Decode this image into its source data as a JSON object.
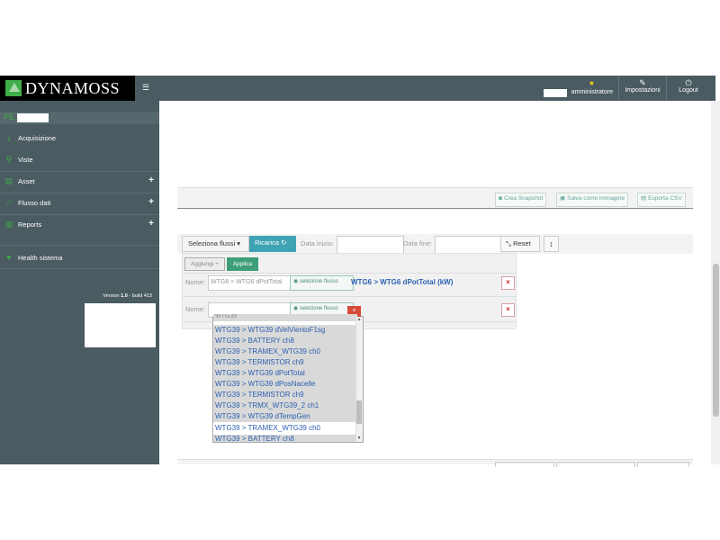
{
  "brand": {
    "name": "DYNAMOSS",
    "accent": "#3fae49"
  },
  "topbar": {
    "user_label": "amministratore",
    "user_icon": "user-icon",
    "settings_label": "Impostazioni",
    "settings_icon": "wrench-icon",
    "logout_label": "Logout",
    "logout_icon": "power-icon"
  },
  "sidebar": {
    "section_label": "PE",
    "items": [
      {
        "label": "Acquisizione",
        "icon": "download-icon"
      },
      {
        "label": "Viste",
        "icon": "map-marker-icon"
      },
      {
        "label": "Asset",
        "icon": "table-icon",
        "expandable": true
      },
      {
        "label": "Flusso dati",
        "icon": "line-chart-icon",
        "expandable": true
      },
      {
        "label": "Reports",
        "icon": "bar-chart-icon",
        "expandable": true
      },
      {
        "label": "Health sistema",
        "icon": "heart-icon"
      }
    ],
    "version_prefix": "Version ",
    "version_number": "1.0",
    "version_build": " - build 413"
  },
  "chart_toolbar": {
    "snapshot_label": "Crea Snapshot",
    "save_image_label": "Salva come immagine",
    "export_csv_label": "Esporta CSV"
  },
  "filters": {
    "seleziona_label": "Seleziona flussi",
    "ricarica_label": "Ricarica",
    "data_inizio_label": "Data inizio:",
    "data_fine_label": "Data fine:",
    "reset_label": "Reset",
    "aggiungi_label": "Aggiungi +",
    "applica_label": "Applica",
    "rows": [
      {
        "nome_label": "Nome:",
        "nome_value": "WTG6 > WTG6 dPotTotal",
        "selezione_label": "selezione flusso",
        "selected_flow": "WTG6 > WTG6 dPotTotal (kW)"
      },
      {
        "nome_label": "Nome:",
        "nome_value": "",
        "selezione_label": "selezione flusso",
        "selected_flow": ""
      }
    ]
  },
  "dropdown": {
    "close_label": "×",
    "top_partial": "WTG39",
    "items": [
      "WTG39 > WTG39 dVelVientoF1sg",
      "WTG39 > BATTERY ch8",
      "WTG39 > TRAMEX_WTG39 ch0",
      "WTG39 > TERMISTOR ch9",
      "WTG39 > WTG39 dPotTotal",
      "WTG39 > WTG39 dPosNacelle",
      "WTG39 > TERMISTOR ch9",
      "WTG39 > TRMX_WTG39_2 ch1",
      "WTG39 > WTG39 dTempGen",
      "WTG39 > TRAMEX_WTG39 ch0",
      "WTG39 > BATTERY ch8"
    ],
    "highlighted_index": 9
  }
}
